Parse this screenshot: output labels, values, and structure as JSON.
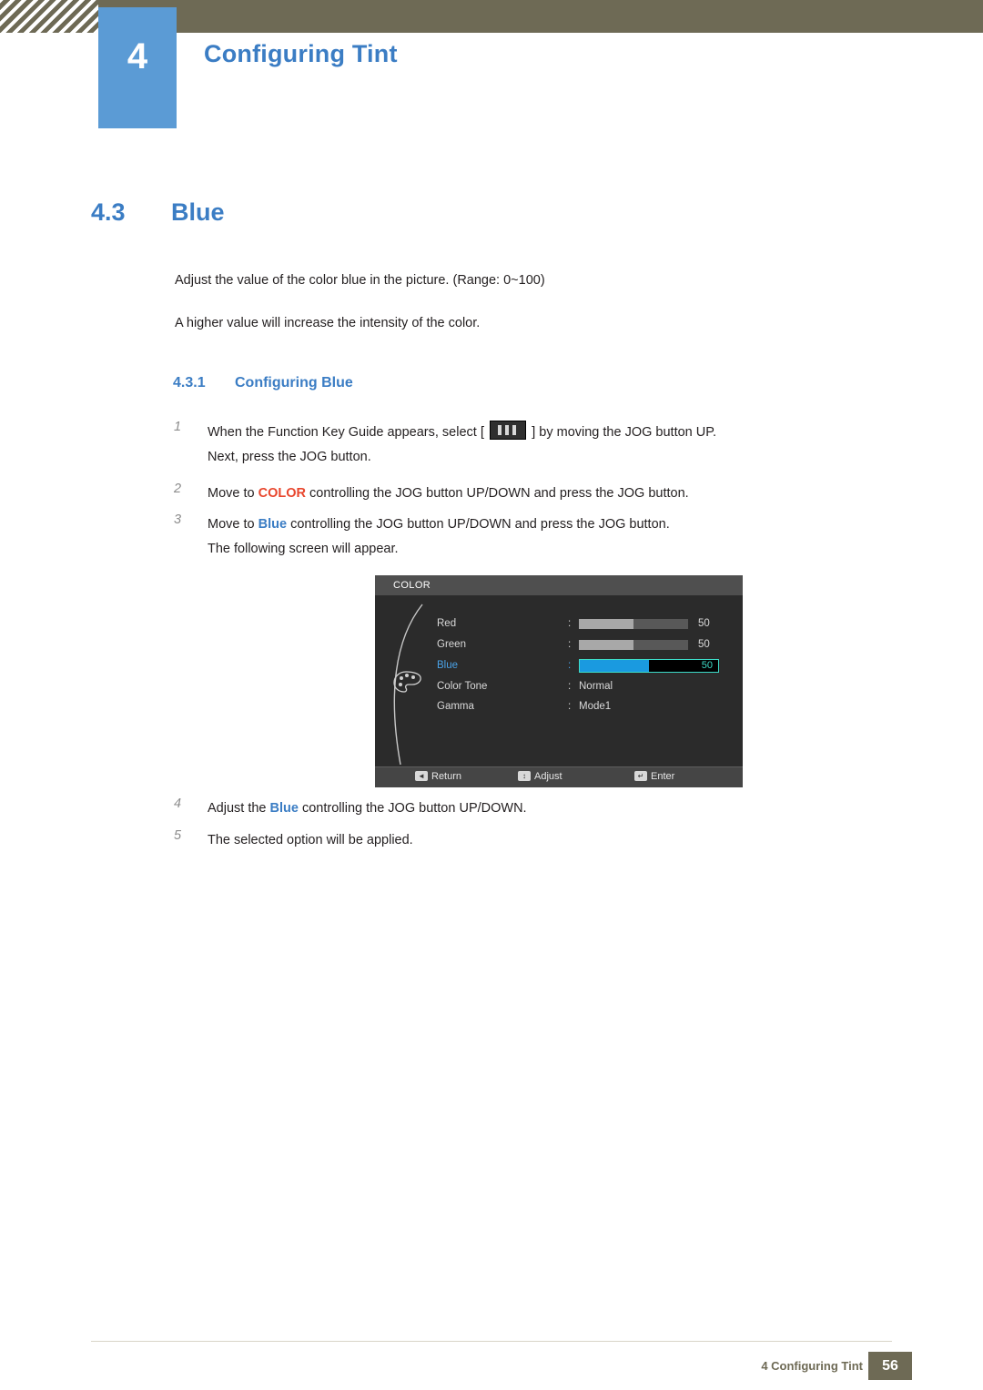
{
  "header": {
    "chapter_number": "4",
    "chapter_title": "Configuring Tint"
  },
  "section": {
    "number": "4.3",
    "title": "Blue"
  },
  "paragraphs": {
    "p1": "Adjust the value of the color blue in the picture. (Range: 0~100)",
    "p2": "A higher value will increase the intensity of the color."
  },
  "subsection": {
    "number": "4.3.1",
    "title": "Configuring Blue"
  },
  "steps": {
    "s1_num": "1",
    "s1_part1": "When the Function Key Guide appears, select",
    "s1_bracket_open": "[",
    "s1_bracket_close": "]",
    "s1_part2": "by moving the JOG button UP.",
    "s1_line2": "Next, press the JOG button.",
    "s2_num": "2",
    "s2_part1": "Move to",
    "s2_keyword": "COLOR",
    "s2_part2": "controlling the JOG button UP/DOWN and press the JOG button.",
    "s3_num": "3",
    "s3_part1": "Move to",
    "s3_keyword": "Blue",
    "s3_part2": "controlling the JOG button UP/DOWN and press the JOG button.",
    "s3_line2": "The following screen will appear.",
    "s4_num": "4",
    "s4_part1": "Adjust the",
    "s4_keyword": "Blue",
    "s4_part2": "controlling the JOG button UP/DOWN.",
    "s5_num": "5",
    "s5_text": "The selected option will be applied."
  },
  "osd": {
    "title": "COLOR",
    "rows": [
      {
        "label": "Red",
        "colon": ":",
        "value": "50",
        "bar_percent": 50
      },
      {
        "label": "Green",
        "colon": ":",
        "value": "50",
        "bar_percent": 50
      },
      {
        "label": "Blue",
        "colon": ":",
        "value": "50",
        "bar_percent": 50
      },
      {
        "label": "Color Tone",
        "colon": ":",
        "value": "Normal"
      },
      {
        "label": "Gamma",
        "colon": ":",
        "value": "Mode1"
      }
    ],
    "footer": [
      {
        "key": "◄",
        "label": "Return"
      },
      {
        "key": "↕",
        "label": "Adjust"
      },
      {
        "key": "↵",
        "label": "Enter"
      }
    ],
    "selected_row": "Blue",
    "accent_color": "#3ddcc8",
    "highlight_color": "#1a9ae0"
  },
  "footer": {
    "text": "4 Configuring Tint",
    "page": "56"
  }
}
